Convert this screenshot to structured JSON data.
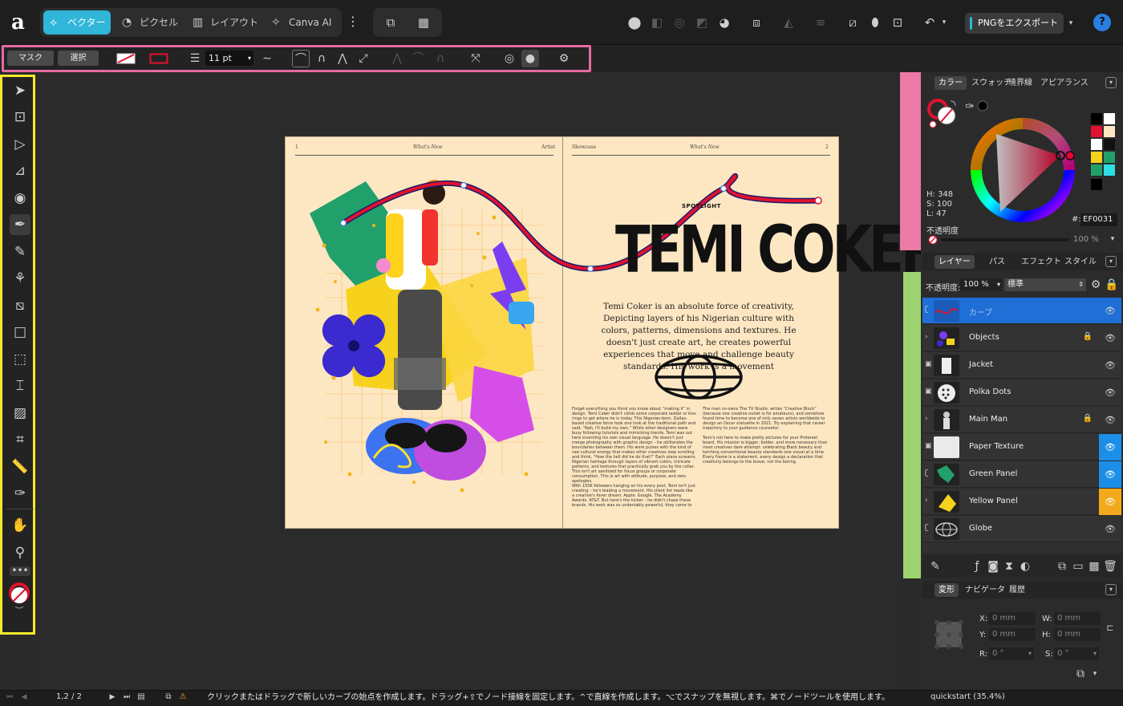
{
  "app": {
    "logo": "a",
    "personas": [
      {
        "label": "ベクター",
        "icon": "vector-persona-icon"
      },
      {
        "label": "ピクセル",
        "icon": "pixel-persona-icon"
      },
      {
        "label": "レイアウト",
        "icon": "layout-persona-icon"
      },
      {
        "label": "Canva AI",
        "icon": "canva-ai-icon"
      }
    ],
    "export_label": "PNGをエクスポート",
    "help": "?"
  },
  "context_bar": {
    "mask_label": "マスク",
    "select_label": "選択",
    "stroke_width": "11 pt"
  },
  "document": {
    "left_page_number": "1",
    "left_running_title": "What's New",
    "left_header_right": "Artist",
    "right_header_left": "Showcase",
    "right_running_title": "What's New",
    "right_page_number": "2",
    "spotlight": "SPOTLIGHT",
    "headline": "TEMI COKER",
    "lead": "Temi Coker is an absolute force of creativity, Depicting layers of his Nigerian culture with colors, patterns, dimensions and textures. He doesn't just create art, he creates powerful experiences that move and challenge beauty standards. His work is a movement",
    "col1": "Forget everything you think you know about “making it” in design. Temi Coker didn't climb some corporate ladder or kiss rings to get where he is today. This Nigerian-born, Dallas-based creative force took one look at the traditional path and said, “Nah, I'll build my own.” While other designers were busy following tutorials and mimicking trends, Temi was out here inventing his own visual language. He doesn't just merge photography with graphic design – he obliterates the boundaries between them. His work pulses with the kind of raw cultural energy that makes other creatives stop scrolling and think, “How the hell did he do that?” Each piece screams Nigerian heritage through layers of vibrant colors, intricate patterns, and textures that practically grab you by the collar. This isn't art sanitized for focus groups or corporate consumption. This is art with attitude, purpose, and zero apologies.",
    "col1b": "With 155K followers hanging on his every post, Temi isn't just creating – he's leading a movement. His client list reads like a creative's fever dream: Apple. Google. The Academy Awards. AT&T. But here's the kicker – he didn't chase these brands. His work was so undeniably powerful, they came to him.",
    "col2": "The man co-owns The TX Studio, writes “Creative Block” (because one creative outlet is for amateurs), and somehow found time to become one of only seven artists worldwide to design an Oscar statuette in 2021. Try explaining that career trajectory to your guidance counselor.",
    "col2b": "Temi's not here to make pretty pictures for your Pinterest board. His mission is bigger, bolder, and more necessary than most creatives dare attempt: celebrating Black beauty and torching conventional beauty standards one visual at a time. Every frame is a statement, every design a declaration that creativity belongs to the brave, not the boring."
  },
  "status": {
    "page": "1,2 / 2",
    "hint": "クリックまたはドラッグで新しいカーブの始点を作成します。ドラッグ+⇧でノード接線を固定します。^で直線を作成します。⌥でスナップを無視します。⌘でノードツールを使用します。",
    "zoom": "quickstart (35.4%)"
  },
  "color_panel": {
    "tabs": [
      "カラー",
      "スウォッチ",
      "境界線",
      "アピアランス"
    ],
    "h": "H: 348",
    "s": "S: 100",
    "l": "L: 47",
    "hex_label": "#:",
    "hex": "EF0031",
    "opacity_label": "不透明度",
    "opacity_value": "100 %",
    "accent": "#EF0031"
  },
  "layers_panel": {
    "tabs": [
      "レイヤー",
      "パス",
      "エフェクト",
      "スタイル"
    ],
    "opacity_label": "不透明度:",
    "opacity_value": "100 %",
    "blend_mode": "標準",
    "layers": [
      {
        "name": "カーブ"
      },
      {
        "name": "Objects"
      },
      {
        "name": "Jacket"
      },
      {
        "name": "Polka Dots"
      },
      {
        "name": "Main Man"
      },
      {
        "name": "Paper Texture"
      },
      {
        "name": "Green Panel"
      },
      {
        "name": "Yellow Panel"
      },
      {
        "name": "Globe"
      }
    ]
  },
  "transform_panel": {
    "tabs": [
      "変形",
      "ナビゲータ",
      "履歴"
    ],
    "x_label": "X:",
    "x": "0 mm",
    "y_label": "Y:",
    "y": "0 mm",
    "w_label": "W:",
    "w": "0 mm",
    "h_label": "H:",
    "h": "0 mm",
    "r_label": "R:",
    "r": "0 °",
    "s_label": "S:",
    "s": "0 °"
  }
}
